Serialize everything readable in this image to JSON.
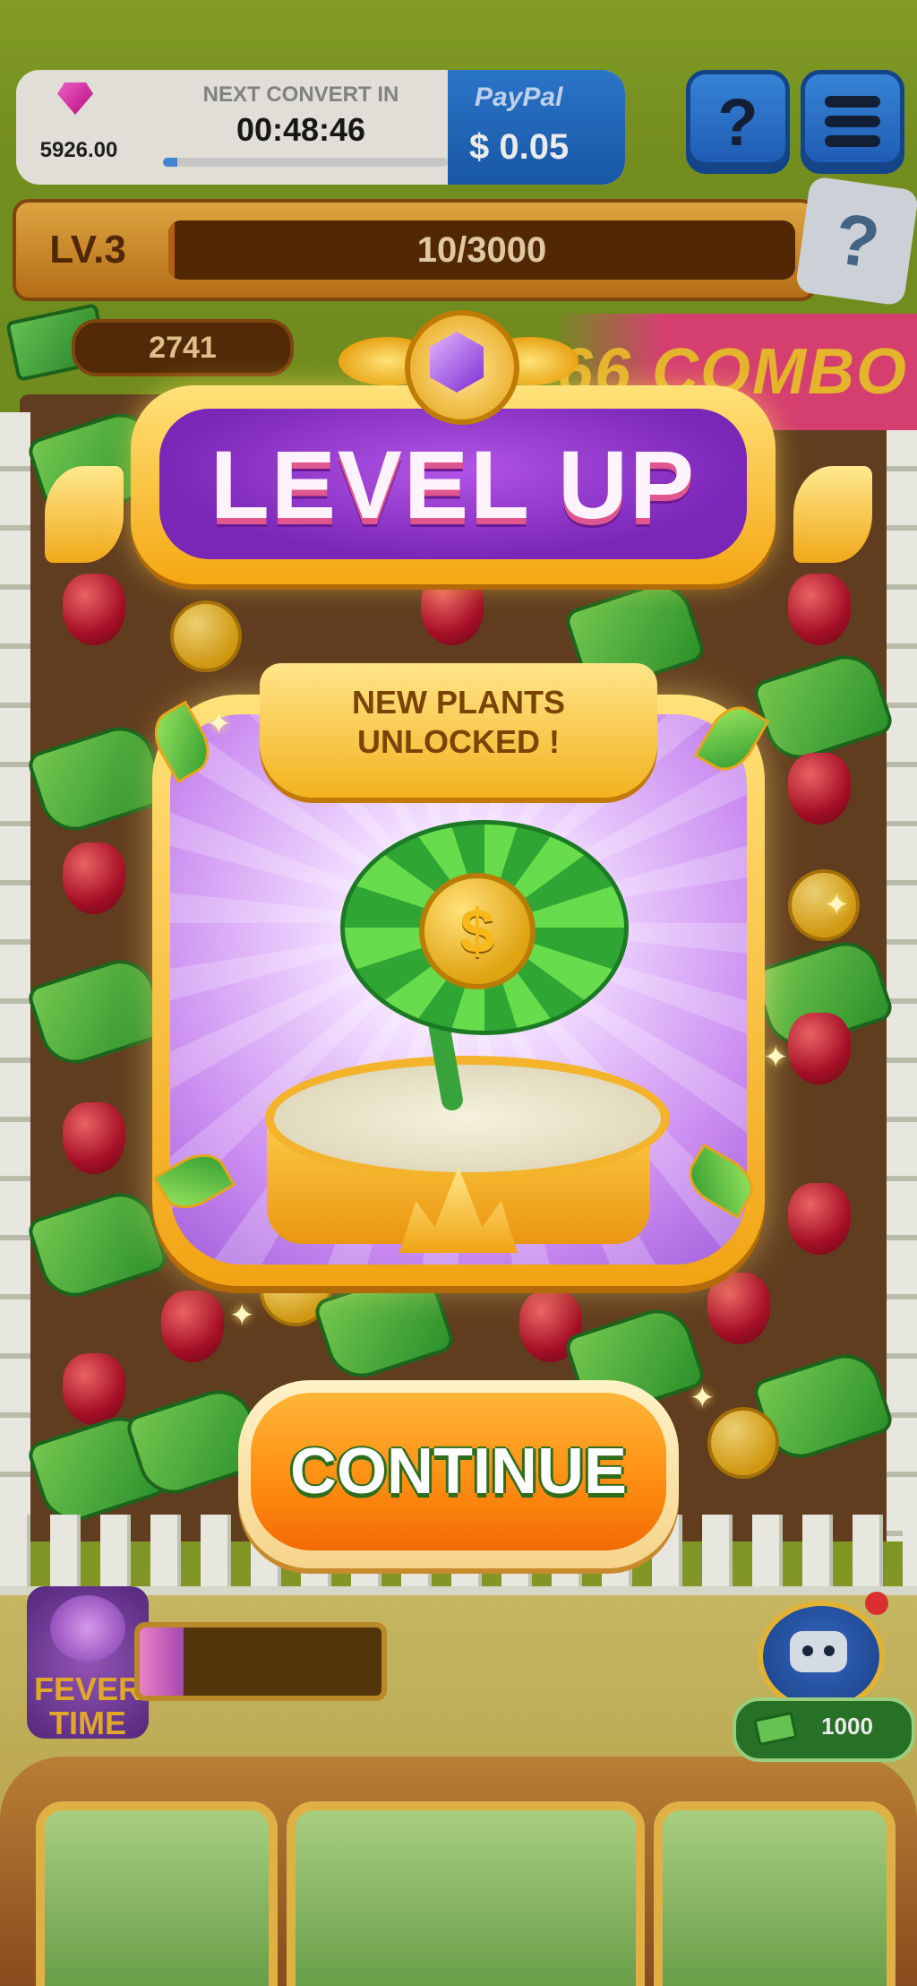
{
  "hud": {
    "gems": "5926.00",
    "convert_label": "NEXT CONVERT IN",
    "convert_timer": "00:48:46",
    "convert_progress": 0.05,
    "paypal_label": "PayPal",
    "paypal_amount": "$ 0.05",
    "help_label": "?"
  },
  "level": {
    "label": "LV.3",
    "progress_text": "10/3000",
    "progress": 0.0033
  },
  "cash": {
    "amount": "2741"
  },
  "combo": {
    "text": "66 COMBO"
  },
  "modal": {
    "title": "LEVEL UP",
    "subtitle_line1": "NEW PLANTS",
    "subtitle_line2": "UNLOCKED !",
    "coin_symbol": "$",
    "continue_label": "CONTINUE"
  },
  "fever": {
    "label": "FEVER\nTIME",
    "progress": 0.18
  },
  "robot": {
    "price": "1000"
  },
  "colors": {
    "accent_orange": "#ff8f12",
    "title_purple": "#7a26b7",
    "frame_gold": "#f2a413",
    "paypal_blue": "#1a5fb4"
  },
  "icons": [
    "gem-icon",
    "paypal-icon",
    "help-icon",
    "menu-icon",
    "mystery-icon",
    "cash-icon",
    "purple-gem-icon",
    "coin-icon",
    "robot-icon"
  ]
}
